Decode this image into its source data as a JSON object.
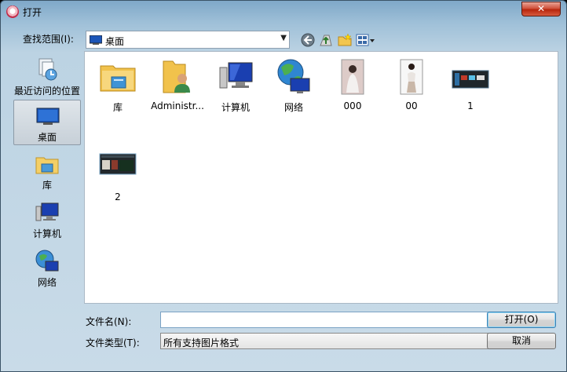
{
  "window": {
    "title": "打开",
    "close_label": "✕"
  },
  "toolbar": {
    "look_in_label": "查找范围(I):",
    "look_in_value": "桌面",
    "icons": [
      "back-icon",
      "up-folder-icon",
      "new-folder-icon",
      "view-menu-icon"
    ]
  },
  "places": [
    {
      "label": "最近访问的位置",
      "icon": "recent-places-icon"
    },
    {
      "label": "桌面",
      "icon": "desktop-icon",
      "selected": true
    },
    {
      "label": "库",
      "icon": "libraries-icon"
    },
    {
      "label": "计算机",
      "icon": "computer-icon"
    },
    {
      "label": "网络",
      "icon": "network-icon"
    }
  ],
  "files": [
    {
      "label": "库",
      "icon": "libraries-folder-icon"
    },
    {
      "label": "Administr...",
      "icon": "user-folder-icon"
    },
    {
      "label": "计算机",
      "icon": "computer-icon"
    },
    {
      "label": "网络",
      "icon": "network-icon"
    },
    {
      "label": "000",
      "icon": "image-thumbnail"
    },
    {
      "label": "00",
      "icon": "image-thumbnail"
    },
    {
      "label": "1",
      "icon": "image-thumbnail"
    },
    {
      "label": "2",
      "icon": "image-thumbnail"
    }
  ],
  "bottom": {
    "filename_label": "文件名(N):",
    "filename_value": "",
    "filetype_label": "文件类型(T):",
    "filetype_value": "所有支持图片格式",
    "open_button": "打开(O)",
    "cancel_button": "取消"
  },
  "colors": {
    "selection": "#c7d0d8",
    "close_red": "#c7361b",
    "pane_border": "#aab8c5"
  }
}
